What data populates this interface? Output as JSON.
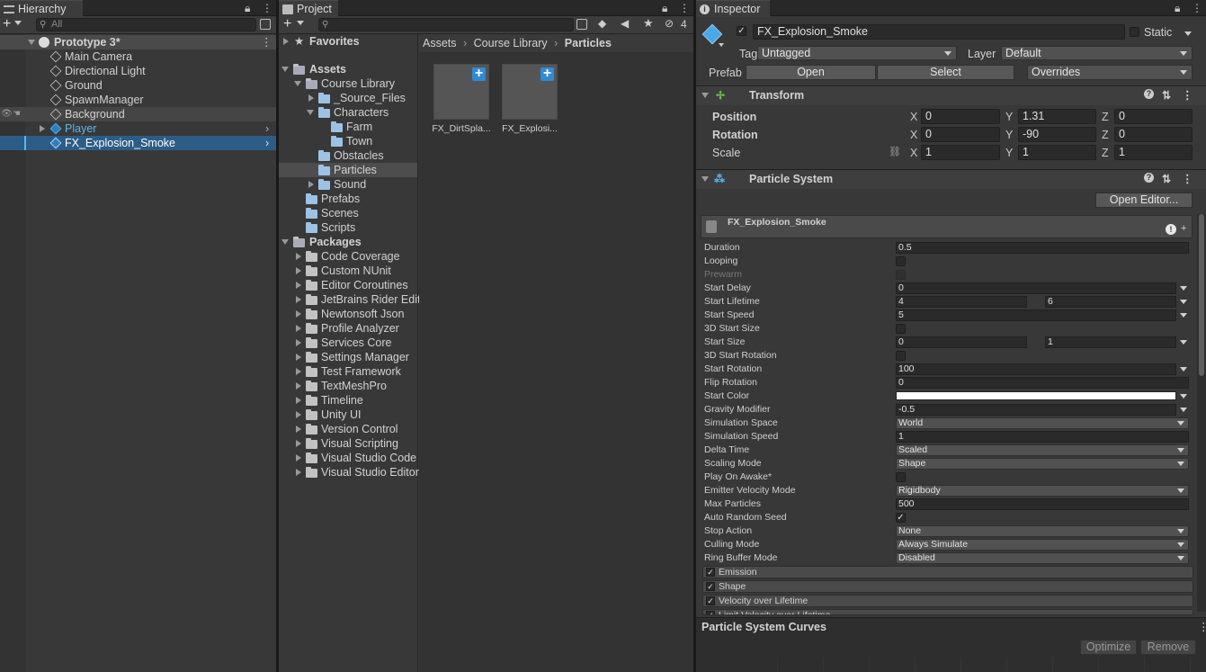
{
  "hierarchy": {
    "tab": "Hierarchy",
    "search_placeholder": "All",
    "scene": "Prototype 3*",
    "items": [
      "Main Camera",
      "Directional Light",
      "Ground",
      "SpawnManager",
      "Background",
      "Player",
      "FX_Explosion_Smoke"
    ]
  },
  "project": {
    "tab": "Project",
    "hidden_count": "4",
    "favorites": "Favorites",
    "assets": "Assets",
    "tree": [
      "Course Library",
      "_Source_Files",
      "Characters",
      "Farm",
      "Town",
      "Obstacles",
      "Particles",
      "Sound",
      "Prefabs",
      "Scenes",
      "Scripts"
    ],
    "packages": "Packages",
    "package_items": [
      "Code Coverage",
      "Custom NUnit",
      "Editor Coroutines",
      "JetBrains Rider Edit",
      "Newtonsoft Json",
      "Profile Analyzer",
      "Services Core",
      "Settings Manager",
      "Test Framework",
      "TextMeshPro",
      "Timeline",
      "Unity UI",
      "Version Control",
      "Visual Scripting",
      "Visual Studio Code",
      "Visual Studio Editor"
    ],
    "breadcrumb": [
      "Assets",
      "Course Library",
      "Particles"
    ],
    "files": [
      "FX_DirtSpla...",
      "FX_Explosi..."
    ]
  },
  "inspector": {
    "tab": "Inspector",
    "object_name": "FX_Explosion_Smoke",
    "static_label": "Static",
    "tag_label": "Tag",
    "tag_value": "Untagged",
    "layer_label": "Layer",
    "layer_value": "Default",
    "prefab_label": "Prefab",
    "prefab_open": "Open",
    "prefab_select": "Select",
    "prefab_overrides": "Overrides",
    "transform": {
      "title": "Transform",
      "position_label": "Position",
      "rotation_label": "Rotation",
      "scale_label": "Scale",
      "axis_x": "X",
      "axis_y": "Y",
      "axis_z": "Z",
      "position": [
        "0",
        "1.31",
        "0"
      ],
      "rotation": [
        "0",
        "-90",
        "0"
      ],
      "scale": [
        "1",
        "1",
        "1"
      ]
    },
    "particle_system": {
      "title": "Particle System",
      "open_editor": "Open Editor...",
      "main_module": "FX_Explosion_Smoke",
      "props": [
        {
          "label": "Duration",
          "value": "0.5"
        },
        {
          "label": "Looping",
          "value": ""
        },
        {
          "label": "Prewarm",
          "value": ""
        },
        {
          "label": "Start Delay",
          "value": "0"
        },
        {
          "label": "Start Lifetime",
          "value": "4",
          "value2": "6"
        },
        {
          "label": "Start Speed",
          "value": "5"
        },
        {
          "label": "3D Start Size",
          "value": ""
        },
        {
          "label": "Start Size",
          "value": "0",
          "value2": "1"
        },
        {
          "label": "3D Start Rotation",
          "value": ""
        },
        {
          "label": "Start Rotation",
          "value": "100"
        },
        {
          "label": "Flip Rotation",
          "value": "0"
        },
        {
          "label": "Start Color",
          "value": ""
        },
        {
          "label": "Gravity Modifier",
          "value": "-0.5"
        },
        {
          "label": "Simulation Space",
          "value": "World"
        },
        {
          "label": "Simulation Speed",
          "value": "1"
        },
        {
          "label": "Delta Time",
          "value": "Scaled"
        },
        {
          "label": "Scaling Mode",
          "value": "Shape"
        },
        {
          "label": "Play On Awake*",
          "value": ""
        },
        {
          "label": "Emitter Velocity Mode",
          "value": "Rigidbody"
        },
        {
          "label": "Max Particles",
          "value": "500"
        },
        {
          "label": "Auto Random Seed",
          "value": "✓"
        },
        {
          "label": "Stop Action",
          "value": "None"
        },
        {
          "label": "Culling Mode",
          "value": "Always Simulate"
        },
        {
          "label": "Ring Buffer Mode",
          "value": "Disabled"
        }
      ],
      "modules": [
        "Emission",
        "Shape",
        "Velocity over Lifetime",
        "Limit Velocity over Lifetime"
      ]
    },
    "curves_title": "Particle System Curves",
    "optimize": "Optimize",
    "remove": "Remove"
  },
  "colors": {
    "selection": "#2c5d87",
    "accent": "#2f8ad8",
    "player_text": "#59b7f0"
  }
}
